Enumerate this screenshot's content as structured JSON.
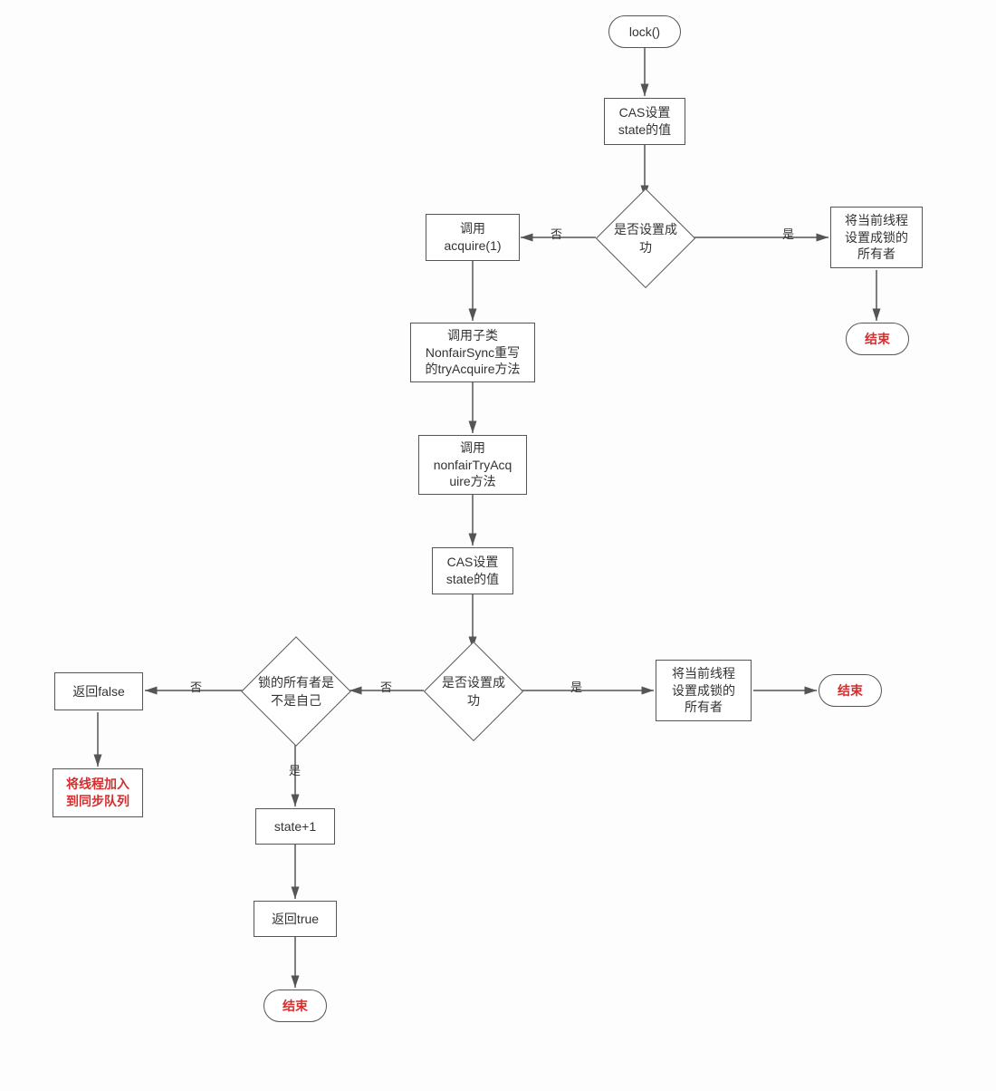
{
  "nodes": {
    "start": "lock()",
    "cas1": "CAS设置\nstate的值",
    "dec1": "是否设置成功",
    "setOwner1": "将当前线程\n设置成锁的\n所有者",
    "end1": "结束",
    "acquire": "调用\nacquire(1)",
    "tryAcquire": "调用子类\nNonfairSync重写\n的tryAcquire方法",
    "nonfairTry": "调用\nnonfairTryAcq\nuire方法",
    "cas2": "CAS设置\nstate的值",
    "dec2": "是否设置成功",
    "setOwner2": "将当前线程\n设置成锁的\n所有者",
    "end2": "结束",
    "dec3": "锁的所有者是\n不是自己",
    "retFalse": "返回false",
    "enqueue": "将线程加入\n到同步队列",
    "stateInc": "state+1",
    "retTrue": "返回true",
    "end3": "结束"
  },
  "edges": {
    "yes": "是",
    "no": "否"
  }
}
